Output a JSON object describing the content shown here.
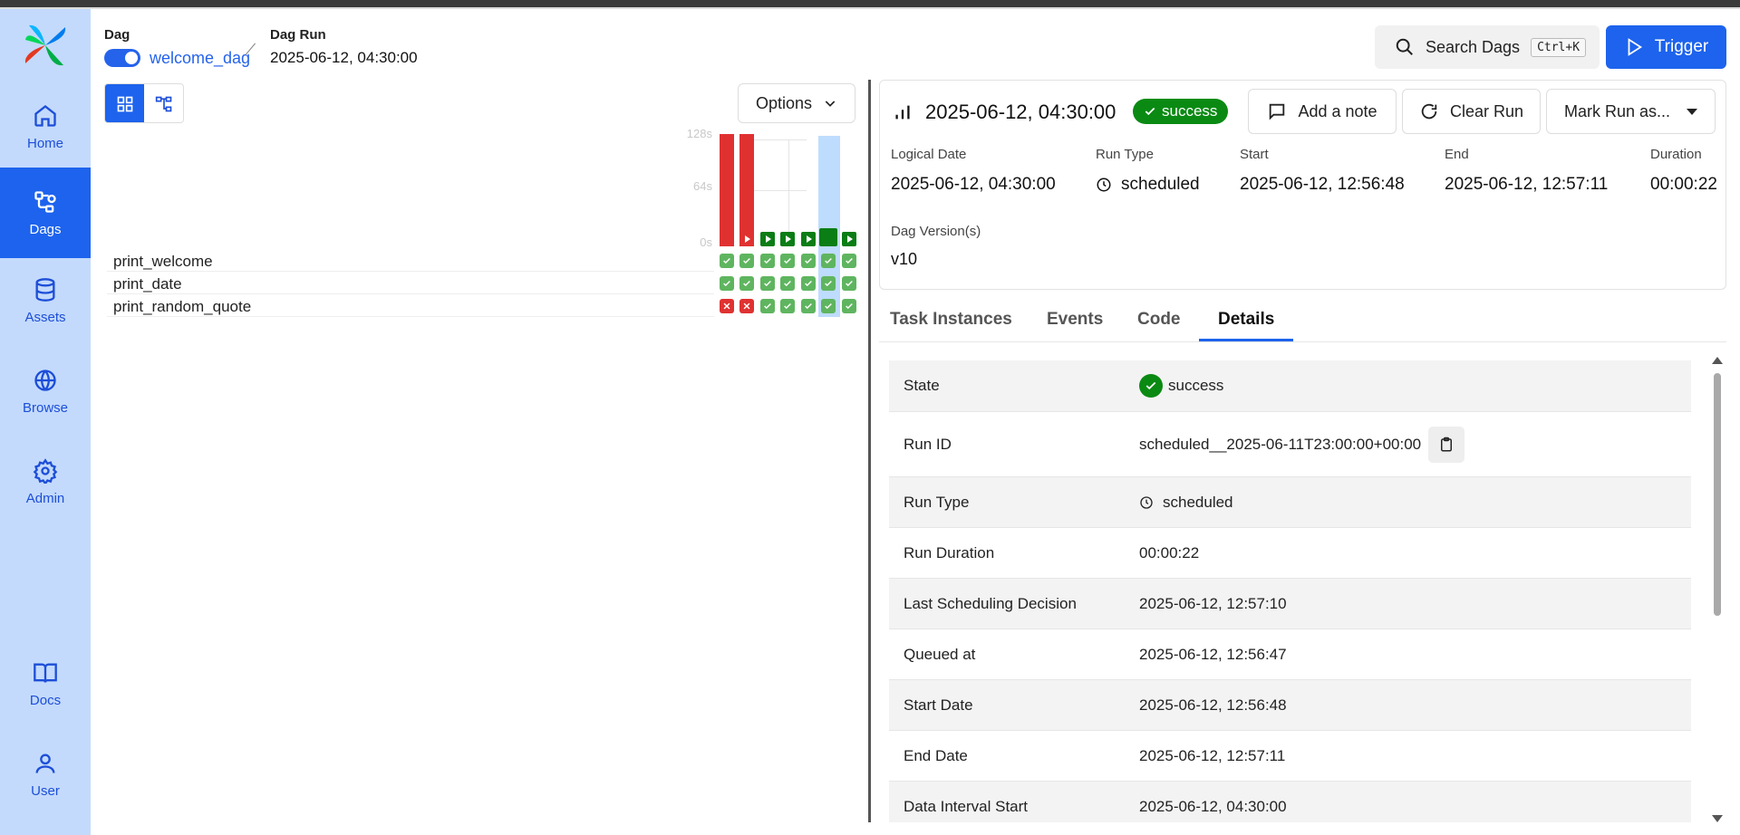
{
  "sidebar": {
    "items": [
      {
        "label": "Home",
        "icon": "home-icon"
      },
      {
        "label": "Dags",
        "icon": "dags-icon",
        "active": true
      },
      {
        "label": "Assets",
        "icon": "database-icon"
      },
      {
        "label": "Browse",
        "icon": "globe-icon"
      },
      {
        "label": "Admin",
        "icon": "gear-icon"
      },
      {
        "label": "Docs",
        "icon": "book-icon"
      },
      {
        "label": "User",
        "icon": "user-icon"
      }
    ]
  },
  "breadcrumb": {
    "dag_label": "Dag",
    "dag_name": "welcome_dag",
    "run_label": "Dag Run",
    "run_value": "2025-06-12, 04:30:00"
  },
  "header": {
    "search_label": "Search Dags",
    "search_shortcut": "Ctrl+K",
    "trigger_label": "Trigger"
  },
  "grid": {
    "options_label": "Options",
    "axis_ticks": [
      "128s",
      "64s",
      "0s"
    ],
    "tasks": [
      {
        "name": "print_welcome",
        "states": [
          "success",
          "success",
          "success",
          "success",
          "success",
          "success",
          "success"
        ]
      },
      {
        "name": "print_date",
        "states": [
          "success",
          "success",
          "success",
          "success",
          "success",
          "success",
          "success"
        ]
      },
      {
        "name": "print_random_quote",
        "states": [
          "failed",
          "failed",
          "success",
          "success",
          "success",
          "success",
          "success"
        ]
      }
    ],
    "run_bars": [
      {
        "state": "failed",
        "duration_fraction": 1.0
      },
      {
        "state": "failed",
        "duration_fraction": 1.0
      },
      {
        "state": "success",
        "duration_fraction": 0.12
      },
      {
        "state": "success",
        "duration_fraction": 0.12
      },
      {
        "state": "success",
        "duration_fraction": 0.12
      },
      {
        "state": "success",
        "duration_fraction": 0.17,
        "selected": true
      },
      {
        "state": "success",
        "duration_fraction": 0.12
      }
    ]
  },
  "run": {
    "title": "2025-06-12, 04:30:00",
    "state": "success",
    "add_note_label": "Add a note",
    "clear_run_label": "Clear Run",
    "mark_run_label": "Mark Run as...",
    "meta": [
      {
        "label": "Logical Date",
        "value": "2025-06-12, 04:30:00"
      },
      {
        "label": "Run Type",
        "value": "scheduled"
      },
      {
        "label": "Start",
        "value": "2025-06-12, 12:56:48"
      },
      {
        "label": "End",
        "value": "2025-06-12, 12:57:11"
      },
      {
        "label": "Duration",
        "value": "00:00:22"
      }
    ],
    "version_label": "Dag Version(s)",
    "version_value": "v10"
  },
  "tabs": [
    "Task Instances",
    "Events",
    "Code",
    "Details"
  ],
  "details": [
    {
      "label": "State",
      "value": "success"
    },
    {
      "label": "Run ID",
      "value": "scheduled__2025-06-11T23:00:00+00:00"
    },
    {
      "label": "Run Type",
      "value": "scheduled"
    },
    {
      "label": "Run Duration",
      "value": "00:00:22"
    },
    {
      "label": "Last Scheduling Decision",
      "value": "2025-06-12, 12:57:10"
    },
    {
      "label": "Queued at",
      "value": "2025-06-12, 12:56:47"
    },
    {
      "label": "Start Date",
      "value": "2025-06-12, 12:56:48"
    },
    {
      "label": "End Date",
      "value": "2025-06-12, 12:57:11"
    },
    {
      "label": "Data Interval Start",
      "value": "2025-06-12, 04:30:00"
    }
  ],
  "colors": {
    "accent": "#1d63ed",
    "sidebar_bg": "#c3dafc",
    "success": "#0a8a13",
    "success_light": "#5fb55f",
    "failed": "#e03131"
  }
}
